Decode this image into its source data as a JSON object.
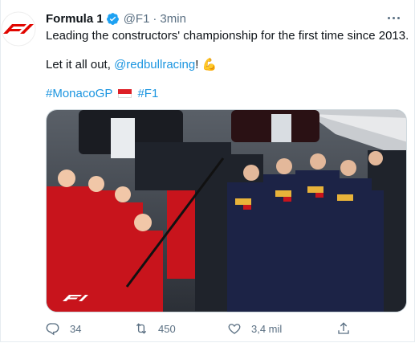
{
  "tweet": {
    "author": {
      "name": "Formula 1",
      "handle": "@F1",
      "separator": "·",
      "time": "3min",
      "avatar_icon": "f1-logo-icon"
    },
    "text": {
      "line1": "Leading the constructors' championship for the first time since 2013.",
      "line2_prefix": "Let it all out, ",
      "mention": "@redbullracing",
      "line2_suffix": "! ",
      "emoji": "💪",
      "hashtag1": "#MonacoGP",
      "hashtag2": "#F1"
    },
    "media": {
      "description_icon": "photo-icon",
      "watermark_icon": "f1-logo-icon"
    },
    "actions": {
      "reply_count": "34",
      "retweet_count": "450",
      "like_count": "3,4 mil"
    }
  },
  "colors": {
    "link": "#1b95e0",
    "muted": "#5b7083",
    "f1_red": "#e10600",
    "verified": "#1da1f2"
  }
}
